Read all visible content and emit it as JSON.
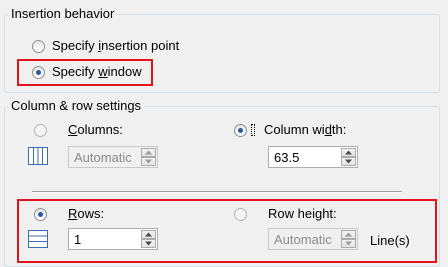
{
  "insertion": {
    "legend": "Insertion behavior",
    "option_point": {
      "prefix": "Specify ",
      "underlined": "i",
      "rest": "nsertion point",
      "selected": false
    },
    "option_window": {
      "prefix": "Specify ",
      "underlined": "w",
      "rest": "indow",
      "selected": true
    }
  },
  "colrow": {
    "legend": "Column & row settings",
    "columns": {
      "underlined": "C",
      "rest": "olumns:",
      "selected": false,
      "value": "Automatic",
      "icon": "columns-icon"
    },
    "column_width": {
      "prefix": "Column wi",
      "underlined": "d",
      "rest": "th:",
      "selected": true,
      "value": "63.5"
    },
    "rows": {
      "underlined": "R",
      "rest": "ows:",
      "selected": true,
      "value": "1",
      "icon": "rows-icon"
    },
    "row_height": {
      "label": "Row height:",
      "selected": false,
      "value": "Automatic",
      "unit": "Line(s)"
    }
  },
  "colors": {
    "highlight": "#e0141e",
    "radio_dot": "#2a5a9a",
    "icon_blue": "#3b6db3"
  }
}
